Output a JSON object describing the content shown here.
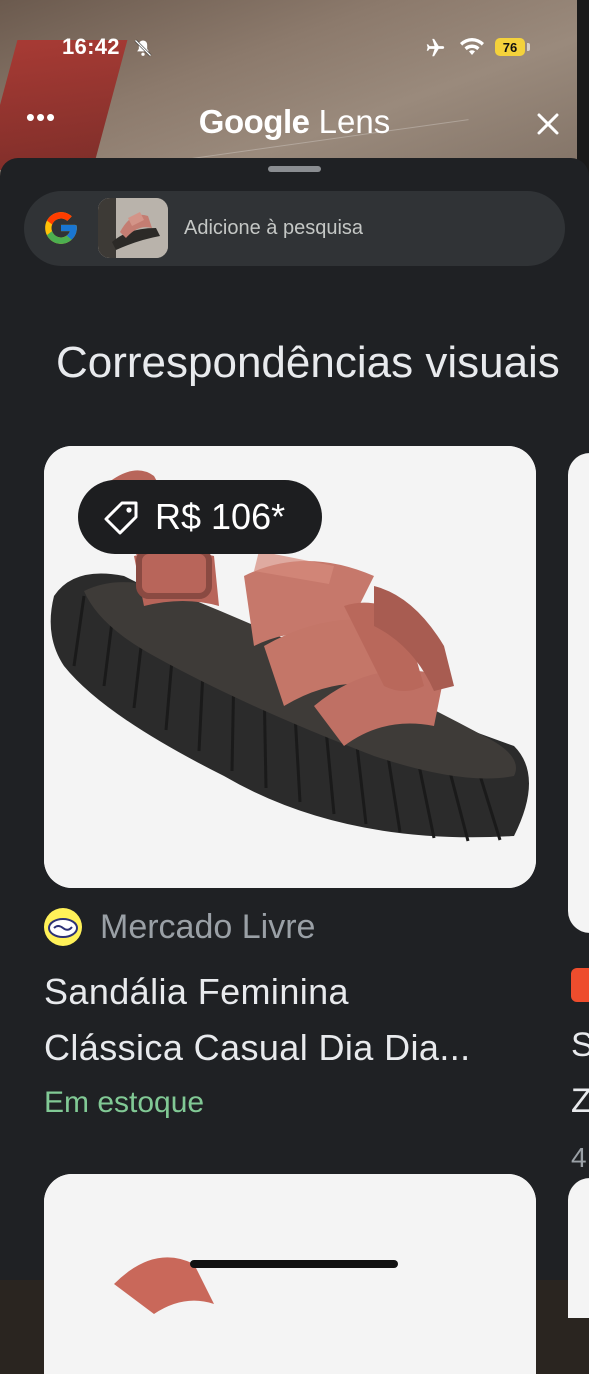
{
  "status_bar": {
    "time": "16:42",
    "battery": "76"
  },
  "top_bar": {
    "title_brand": "Google",
    "title_product": "Lens",
    "more_label": "•••"
  },
  "search": {
    "placeholder": "Adicione à pesquisa"
  },
  "section": {
    "title": "Correspondências visuais"
  },
  "results": [
    {
      "price": "R$ 106*",
      "source": "Mercado Livre",
      "title_line1": "Sandália Feminina",
      "title_line2": "Clássica Casual Dia Dia...",
      "availability": "Em estoque"
    }
  ],
  "peek": {
    "line1": "S",
    "line2": "Z",
    "line3": "4"
  },
  "colors": {
    "accent_green": "#81c995",
    "sheet_bg": "#1f2124",
    "battery": "#f4d23b"
  }
}
